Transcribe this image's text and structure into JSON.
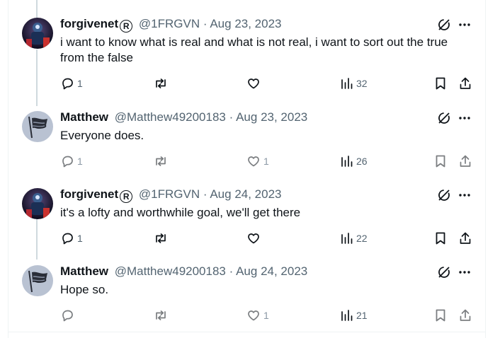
{
  "tweets": [
    {
      "name": "forgivenet",
      "badge": "R",
      "handle": "@1FRGVN",
      "separator": "·",
      "date": "Aug 23, 2023",
      "text": "i want to know what is real and what is not real, i want to sort out the true from the false",
      "reply_count": "1",
      "like_count": "",
      "view_count": "32"
    },
    {
      "name": "Matthew",
      "handle": "@Matthew49200183",
      "separator": "·",
      "date": "Aug 23, 2023",
      "text": "Everyone does.",
      "reply_count": "1",
      "like_count": "1",
      "view_count": "26"
    },
    {
      "name": "forgivenet",
      "badge": "R",
      "handle": "@1FRGVN",
      "separator": "·",
      "date": "Aug 24, 2023",
      "text": "it's a lofty and worthwhile goal, we'll get there",
      "reply_count": "1",
      "like_count": "",
      "view_count": "22"
    },
    {
      "name": "Matthew",
      "handle": "@Matthew49200183",
      "separator": "·",
      "date": "Aug 24, 2023",
      "text": "Hope so.",
      "reply_count": "",
      "like_count": "1",
      "view_count": "21"
    }
  ],
  "icons": {
    "grok": "grok-icon",
    "more": "more-icon",
    "reply": "reply-icon",
    "retweet": "retweet-icon",
    "like": "heart-icon",
    "views": "views-icon",
    "bookmark": "bookmark-icon",
    "share": "share-icon"
  },
  "colors": {
    "text": "#0f1419",
    "secondary": "#536471",
    "border": "#eff3f4",
    "thread_line": "#cfd9de"
  }
}
